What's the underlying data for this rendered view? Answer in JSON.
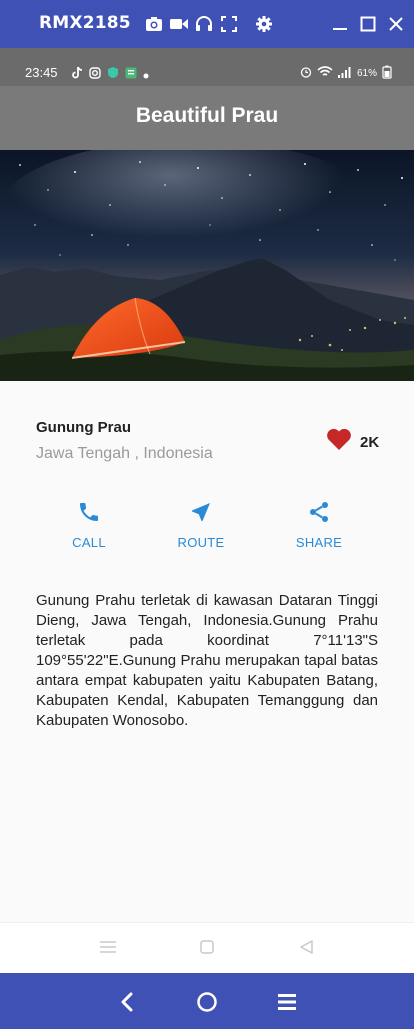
{
  "window": {
    "title": "RMX2185",
    "icons": [
      "camera-icon",
      "video-icon",
      "headphones-icon",
      "fullscreen-icon",
      "gear-icon",
      "minimize-icon",
      "maximize-icon",
      "close-icon"
    ]
  },
  "status_bar": {
    "time": "23:45",
    "battery": "61%",
    "left_icons": [
      "tiktok-icon",
      "instagram-icon",
      "vpn-shield-icon",
      "app-icon",
      "dot-icon"
    ],
    "right_icons": [
      "alarm-icon",
      "wifi-icon",
      "signal-icon",
      "battery-icon"
    ]
  },
  "app_bar": {
    "title": "Beautiful Prau"
  },
  "hero": {
    "image": "mountain-camping-night-sky"
  },
  "place": {
    "name": "Gunung Prau",
    "location": "Jawa Tengah , Indonesia",
    "likes": "2K",
    "like_icon": "heart-icon",
    "like_color": "#c62828"
  },
  "actions": [
    {
      "label": "CALL",
      "icon": "phone-icon"
    },
    {
      "label": "ROUTE",
      "icon": "navigation-icon"
    },
    {
      "label": "SHARE",
      "icon": "share-icon"
    }
  ],
  "accent_color": "#2a8ad6",
  "description": "Gunung Prahu terletak di kawasan Dataran Tinggi Dieng, Jawa Tengah, Indonesia.Gunung Prahu terletak pada koordinat 7°11'13\"S 109°55'22\"E.Gunung Prahu merupakan tapal batas antara empat kabupaten yaitu Kabupaten Batang, Kabupaten Kendal, Kabupaten Temanggung dan Kabupaten Wonosobo.",
  "android_nav": [
    "menu-icon",
    "home-square-icon",
    "back-triangle-icon"
  ],
  "emulator_controls": [
    "back-chevron-icon",
    "home-circle-icon",
    "menu-lines-icon"
  ]
}
